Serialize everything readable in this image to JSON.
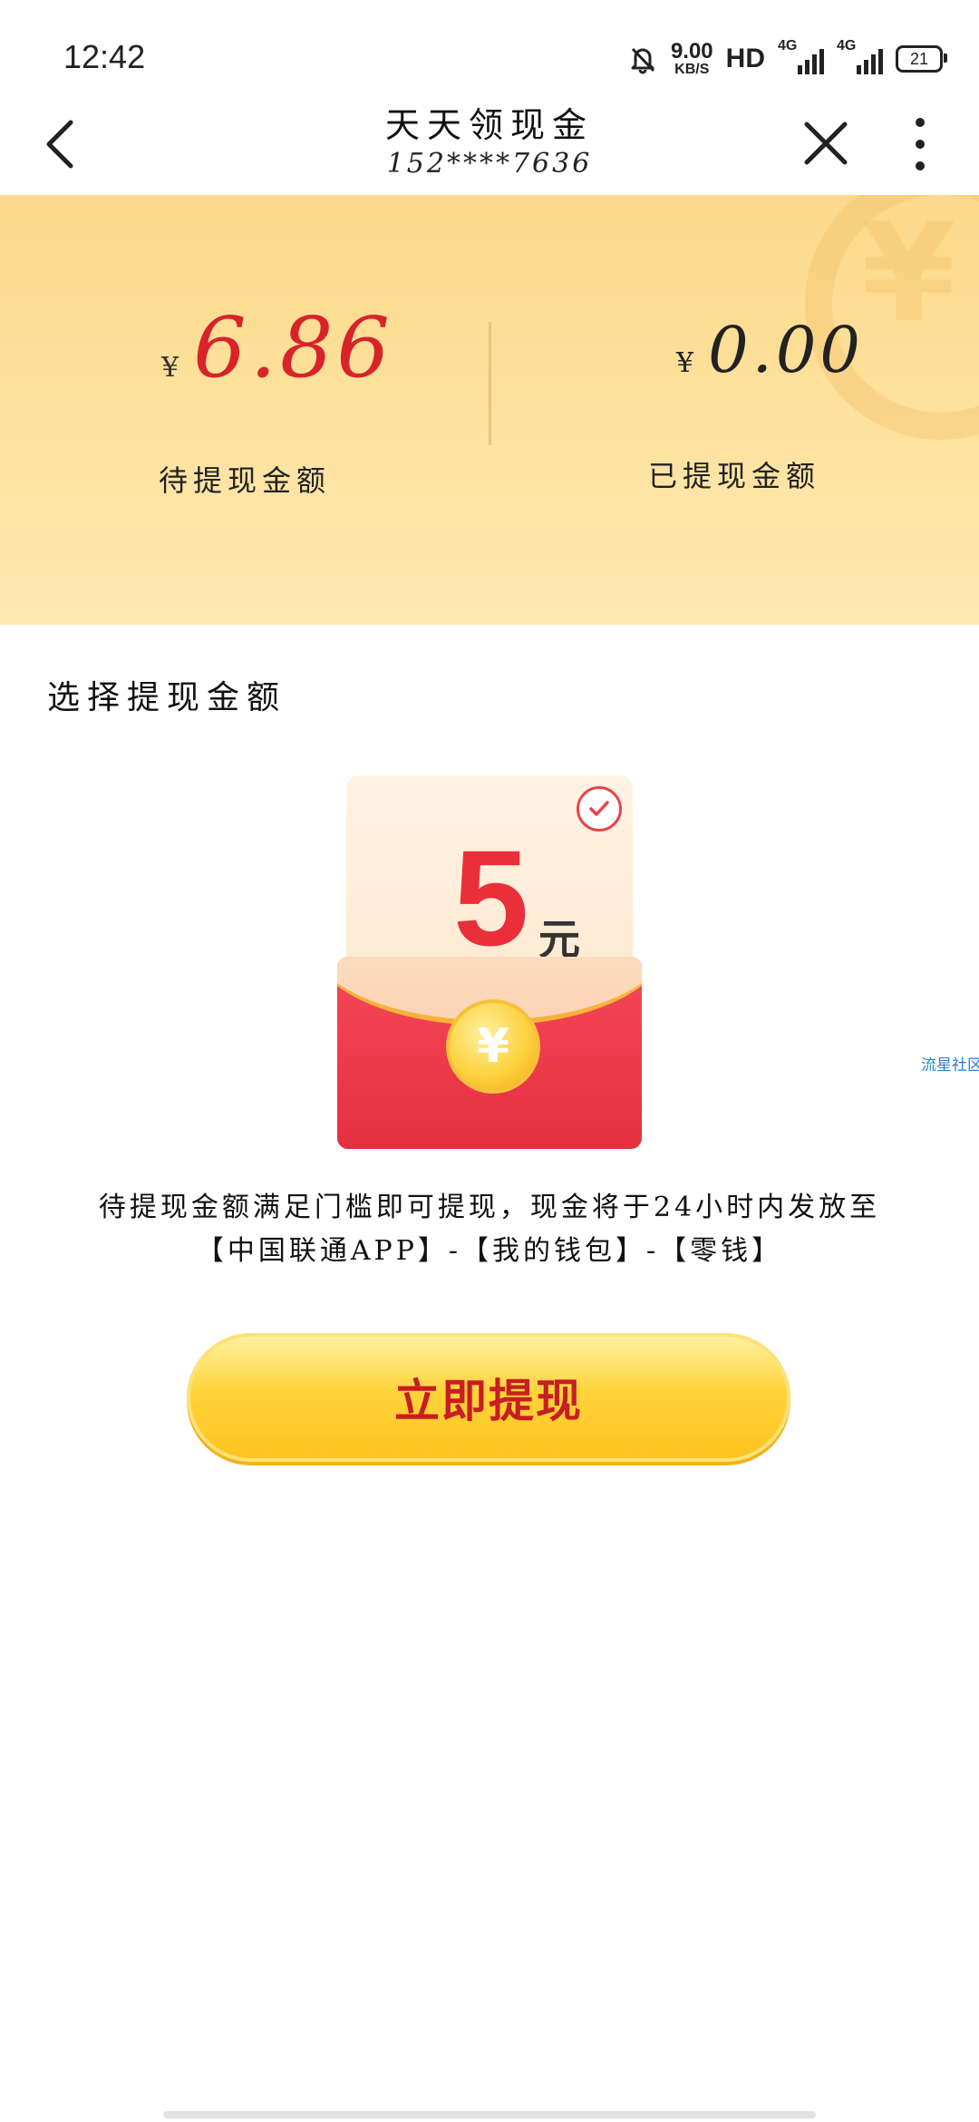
{
  "status_bar": {
    "time": "12:42",
    "net_speed_value": "9.00",
    "net_speed_unit": "KB/S",
    "hd_label": "HD",
    "signal1_label": "4G",
    "signal2_label": "4G",
    "battery": "21"
  },
  "nav": {
    "title": "天天领现金",
    "subtitle": "152****7636",
    "back_icon": "chevron-left",
    "close_icon": "close",
    "more_icon": "more-vertical"
  },
  "balance": {
    "currency": "¥",
    "pending_amount": "6.86",
    "pending_label": "待提现金额",
    "withdrawn_amount": "0.00",
    "withdrawn_label": "已提现金额"
  },
  "select": {
    "title": "选择提现金额",
    "option_value": "5",
    "option_unit": "元",
    "coin_symbol": "¥",
    "selected": true
  },
  "watermark": "流星社区",
  "note": "待提现金额满足门槛即可提现，现金将于24小时内发放至【中国联通APP】-【我的钱包】-【零钱】",
  "button": {
    "label": "立即提现"
  },
  "colors": {
    "banner": "#fde09a",
    "accent_red": "#d8232a",
    "button": "#ffd43b"
  }
}
